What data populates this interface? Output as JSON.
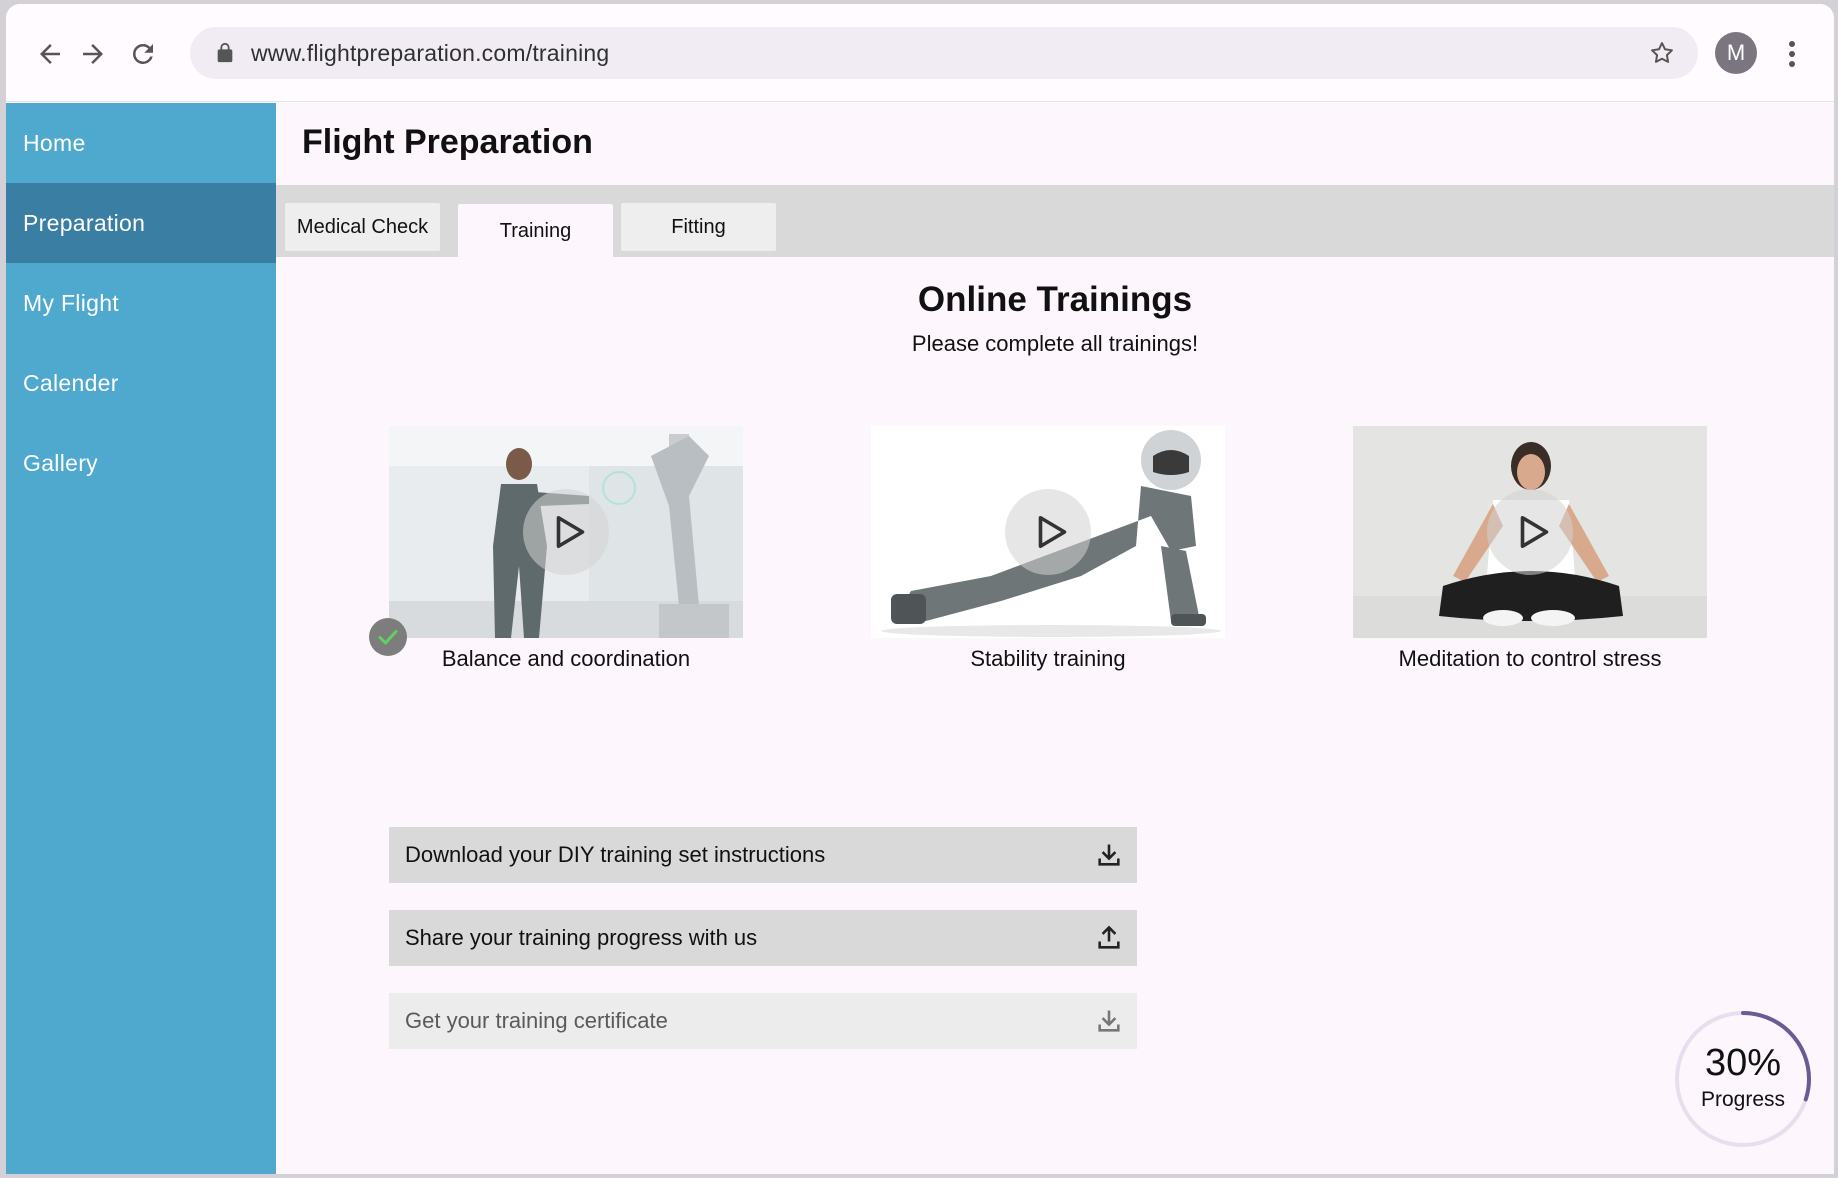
{
  "browser": {
    "url": "www.flightpreparation.com/training",
    "profile_initial": "M",
    "icons": [
      "back-arrow-icon",
      "forward-arrow-icon",
      "reload-icon",
      "lock-icon",
      "star-icon",
      "more-vert-icon"
    ]
  },
  "sidebar": {
    "items": [
      {
        "label": "Home",
        "active": false
      },
      {
        "label": "Preparation",
        "active": true
      },
      {
        "label": "My Flight",
        "active": false
      },
      {
        "label": "Calender",
        "active": false
      },
      {
        "label": "Gallery",
        "active": false
      }
    ]
  },
  "header": {
    "title": "Flight Preparation"
  },
  "tabs": [
    {
      "label": "Medical Check",
      "active": false
    },
    {
      "label": "Training",
      "active": true
    },
    {
      "label": "Fitting",
      "active": false
    }
  ],
  "section": {
    "title": "Online Trainings",
    "subtitle": "Please complete all trainings!"
  },
  "trainings": [
    {
      "label": "Balance and coordination",
      "completed": true,
      "icon": "play-icon"
    },
    {
      "label": "Stability training",
      "completed": false,
      "icon": "play-icon"
    },
    {
      "label": "Meditation to control stress",
      "completed": false,
      "icon": "play-icon"
    }
  ],
  "actions": [
    {
      "label": "Download your DIY training set instructions",
      "icon": "download-icon",
      "enabled": true
    },
    {
      "label": "Share your training progress with us",
      "icon": "upload-icon",
      "enabled": true
    },
    {
      "label": "Get your training certificate",
      "icon": "download-icon",
      "enabled": false
    }
  ],
  "progress": {
    "value": "30%",
    "fraction": 0.3,
    "label": "Progress"
  },
  "colors": {
    "sidebar": "#4fa8cd",
    "sidebar_active": "#3a7fa3",
    "progress_arc": "#6b5b95",
    "check": "#5fd15f"
  }
}
